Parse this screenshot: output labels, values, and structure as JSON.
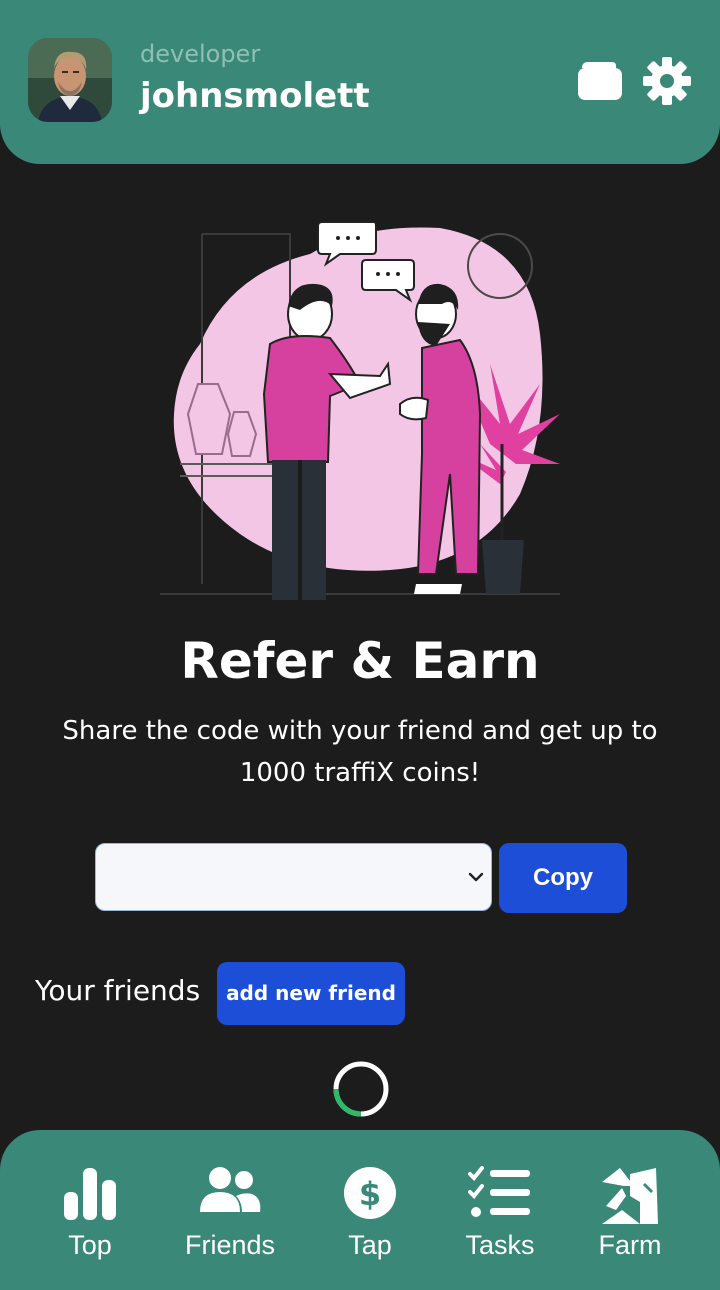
{
  "header": {
    "role": "developer",
    "username": "johnsmolett"
  },
  "hero": {
    "title": "Refer & Earn",
    "subtitle": "Share the code with your friend and get up to 1000 traffiX coins!"
  },
  "referral": {
    "selected_code": "",
    "copy_label": "Copy"
  },
  "friends": {
    "label": "Your friends",
    "add_label": "add new friend"
  },
  "nav": {
    "items": [
      {
        "label": "Top",
        "icon": "bar-chart-icon"
      },
      {
        "label": "Friends",
        "icon": "users-icon"
      },
      {
        "label": "Tap",
        "icon": "dollar-circle-icon"
      },
      {
        "label": "Tasks",
        "icon": "task-list-icon"
      },
      {
        "label": "Farm",
        "icon": "farm-icon"
      }
    ]
  },
  "colors": {
    "teal": "#398878",
    "background": "#1c1c1c",
    "button_blue": "#1d4ed8",
    "illustration_pink": "#f4c6e6",
    "illustration_magenta": "#d6409f"
  }
}
